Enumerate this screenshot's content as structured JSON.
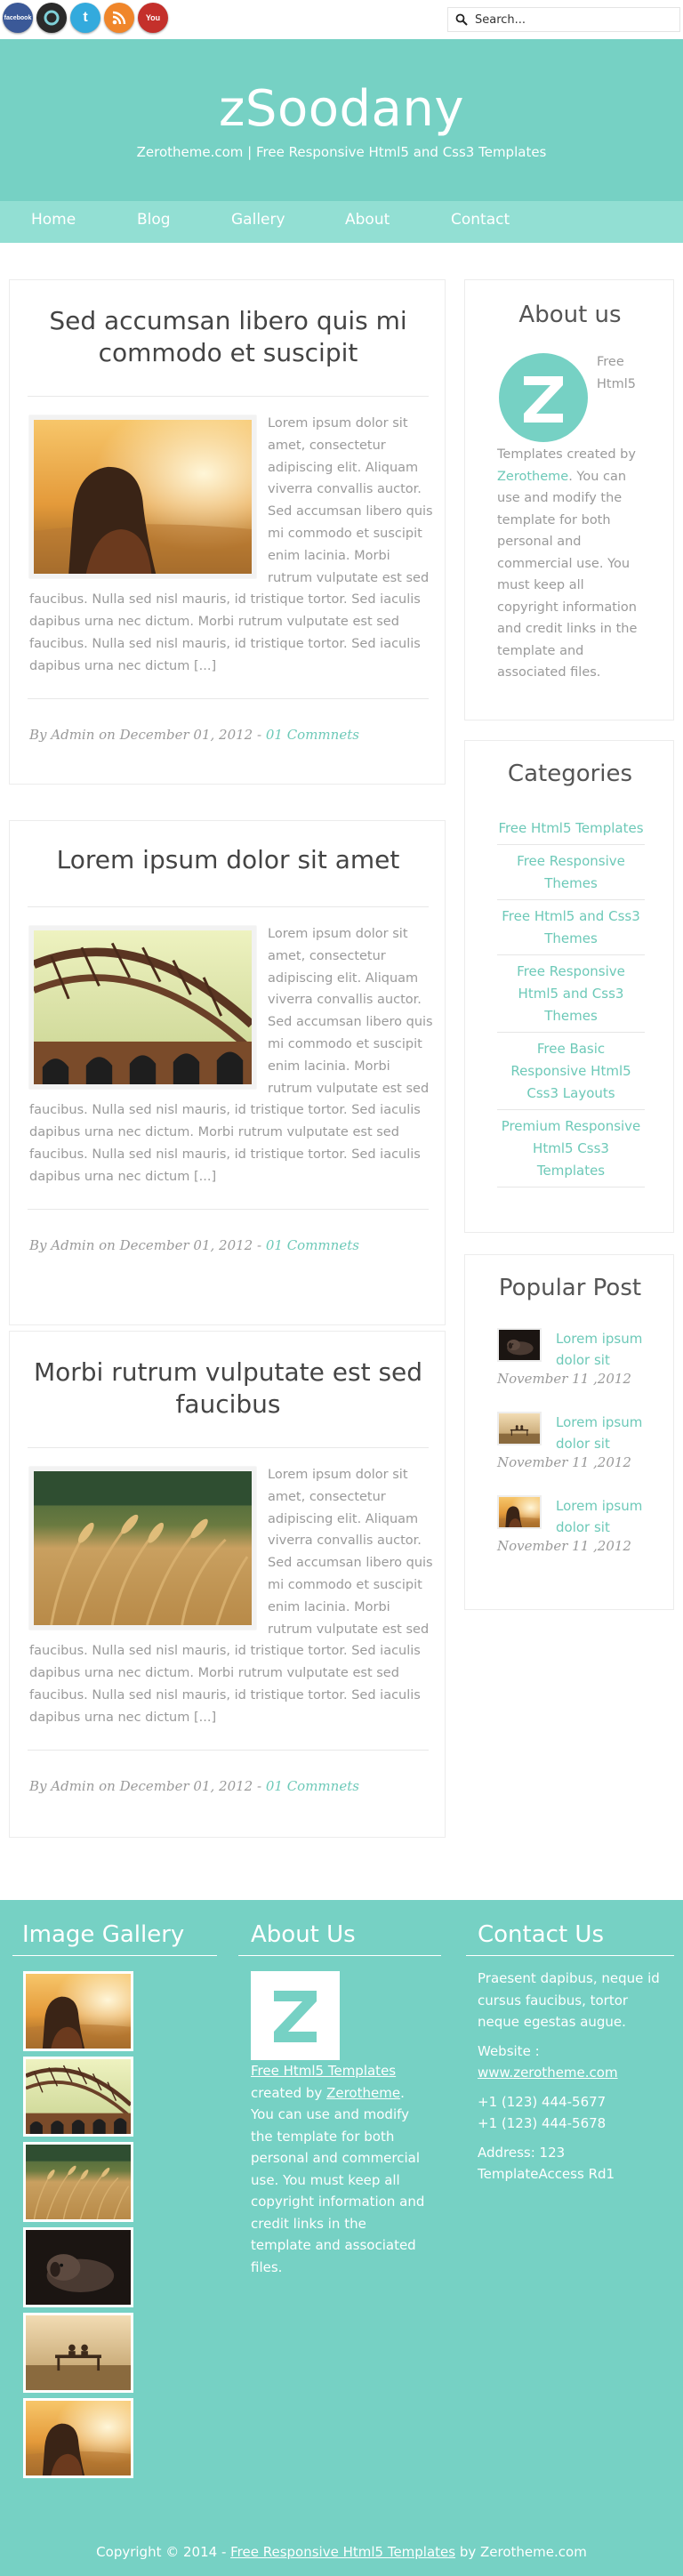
{
  "topbar": {
    "social": [
      {
        "name": "facebook-icon",
        "label": "facebook",
        "color": "#3b5998"
      },
      {
        "name": "digg-icon",
        "label": "",
        "color": "#2a2a2a"
      },
      {
        "name": "twitter-icon",
        "label": "t",
        "color": "#33aadd"
      },
      {
        "name": "rss-icon",
        "label": "",
        "color": "#f0862a"
      },
      {
        "name": "youtube-icon",
        "label": "You",
        "color": "#c4302b"
      }
    ],
    "search_placeholder": "Search..."
  },
  "header": {
    "site_title": "zSoodany",
    "tagline": "Zerotheme.com | Free Responsive Html5 and Css3 Templates",
    "accent_color": "#76d1c4"
  },
  "nav": [
    "Home",
    "Blog",
    "Gallery",
    "About",
    "Contact"
  ],
  "posts": [
    {
      "title_line1": "Sed accumsan libero quis mi",
      "title_line2": "commodo et suscipit",
      "body": "Lorem ipsum dolor sit amet, consectetur adipiscing elit. Aliquam viverra convallis auctor. Sed accumsan libero quis mi commodo et suscipit enim lacinia. Morbi rutrum vulputate est sed faucibus. Nulla sed nisl mauris, id tristique tortor. Sed iaculis dapibus urna nec dictum. Morbi rutrum vulputate est sed faucibus. Nulla sed nisl mauris, id tristique tortor. Sed iaculis dapibus urna nec dictum [...]",
      "meta_prefix": "By Admin on December 01, 2012 - ",
      "comments": "01 Commnets",
      "image": "girl-sunset"
    },
    {
      "title_line1": "Lorem ipsum dolor sit amet",
      "title_line2": "",
      "body": "Lorem ipsum dolor sit amet, consectetur adipiscing elit. Aliquam viverra convallis auctor. Sed accumsan libero quis mi commodo et suscipit enim lacinia. Morbi rutrum vulputate est sed faucibus. Nulla sed nisl mauris, id tristique tortor. Sed iaculis dapibus urna nec dictum. Morbi rutrum vulputate est sed faucibus. Nulla sed nisl mauris, id tristique tortor. Sed iaculis dapibus urna nec dictum [...]",
      "meta_prefix": "By Admin on December 01, 2012 - ",
      "comments": "01 Commnets",
      "image": "bridge"
    },
    {
      "title_line1": "Morbi rutrum vulputate est sed",
      "title_line2": "faucibus",
      "body": "Lorem ipsum dolor sit amet, consectetur adipiscing elit. Aliquam viverra convallis auctor. Sed accumsan libero quis mi commodo et suscipit enim lacinia. Morbi rutrum vulputate est sed faucibus. Nulla sed nisl mauris, id tristique tortor. Sed iaculis dapibus urna nec dictum. Morbi rutrum vulputate est sed faucibus. Nulla sed nisl mauris, id tristique tortor. Sed iaculis dapibus urna nec dictum [...]",
      "meta_prefix": "By Admin on December 01, 2012 - ",
      "comments": "01 Commnets",
      "image": "wheat"
    }
  ],
  "sidebar": {
    "about_title": "About us",
    "about_text_pre": "Free Html5 Templates created by ",
    "about_link": "Zerotheme",
    "about_text_post": ". You can use and modify the template for both personal and commercial use. You must keep all copyright information and credit links in the template and associated files.",
    "categories_title": "Categories",
    "categories": [
      "Free Html5 Templates",
      "Free Responsive Themes",
      "Free Html5 and Css3 Themes",
      "Free Responsive Html5 and Css3 Themes",
      "Free Basic Responsive Html5 Css3 Layouts",
      "Premium Responsive Html5 Css3 Templates"
    ],
    "popular_title": "Popular Post",
    "popular": [
      {
        "title": "Lorem ipsum dolor sit",
        "date": "November 11 ,2012"
      },
      {
        "title": "Lorem ipsum dolor sit",
        "date": "November 11 ,2012"
      },
      {
        "title": "Lorem ipsum dolor sit",
        "date": "November 11 ,2012"
      }
    ]
  },
  "footer": {
    "gallery_title": "Image Gallery",
    "about_title": "About Us",
    "about_link1": "Free Html5 Templates",
    "about_mid": " created by ",
    "about_link2": "Zerotheme",
    "about_rest": ". You can use and modify the template for both personal and commercial use. You must keep all copyright information and credit links in the template and associated files.",
    "contact_title": "Contact Us",
    "contact_intro": "Praesent dapibus, neque id cursus faucibus, tortor neque egestas augue.",
    "website_label": "Website :",
    "website": "www.zerotheme.com",
    "phone1": "+1 (123) 444-5677",
    "phone2": "+1 (123) 444-5678",
    "address": "Address: 123 TemplateAccess Rd1",
    "copyright_pre": "Copyright © 2014 - ",
    "copyright_link": "Free Responsive Html5 Templates",
    "copyright_post": " by Zerotheme.com"
  }
}
